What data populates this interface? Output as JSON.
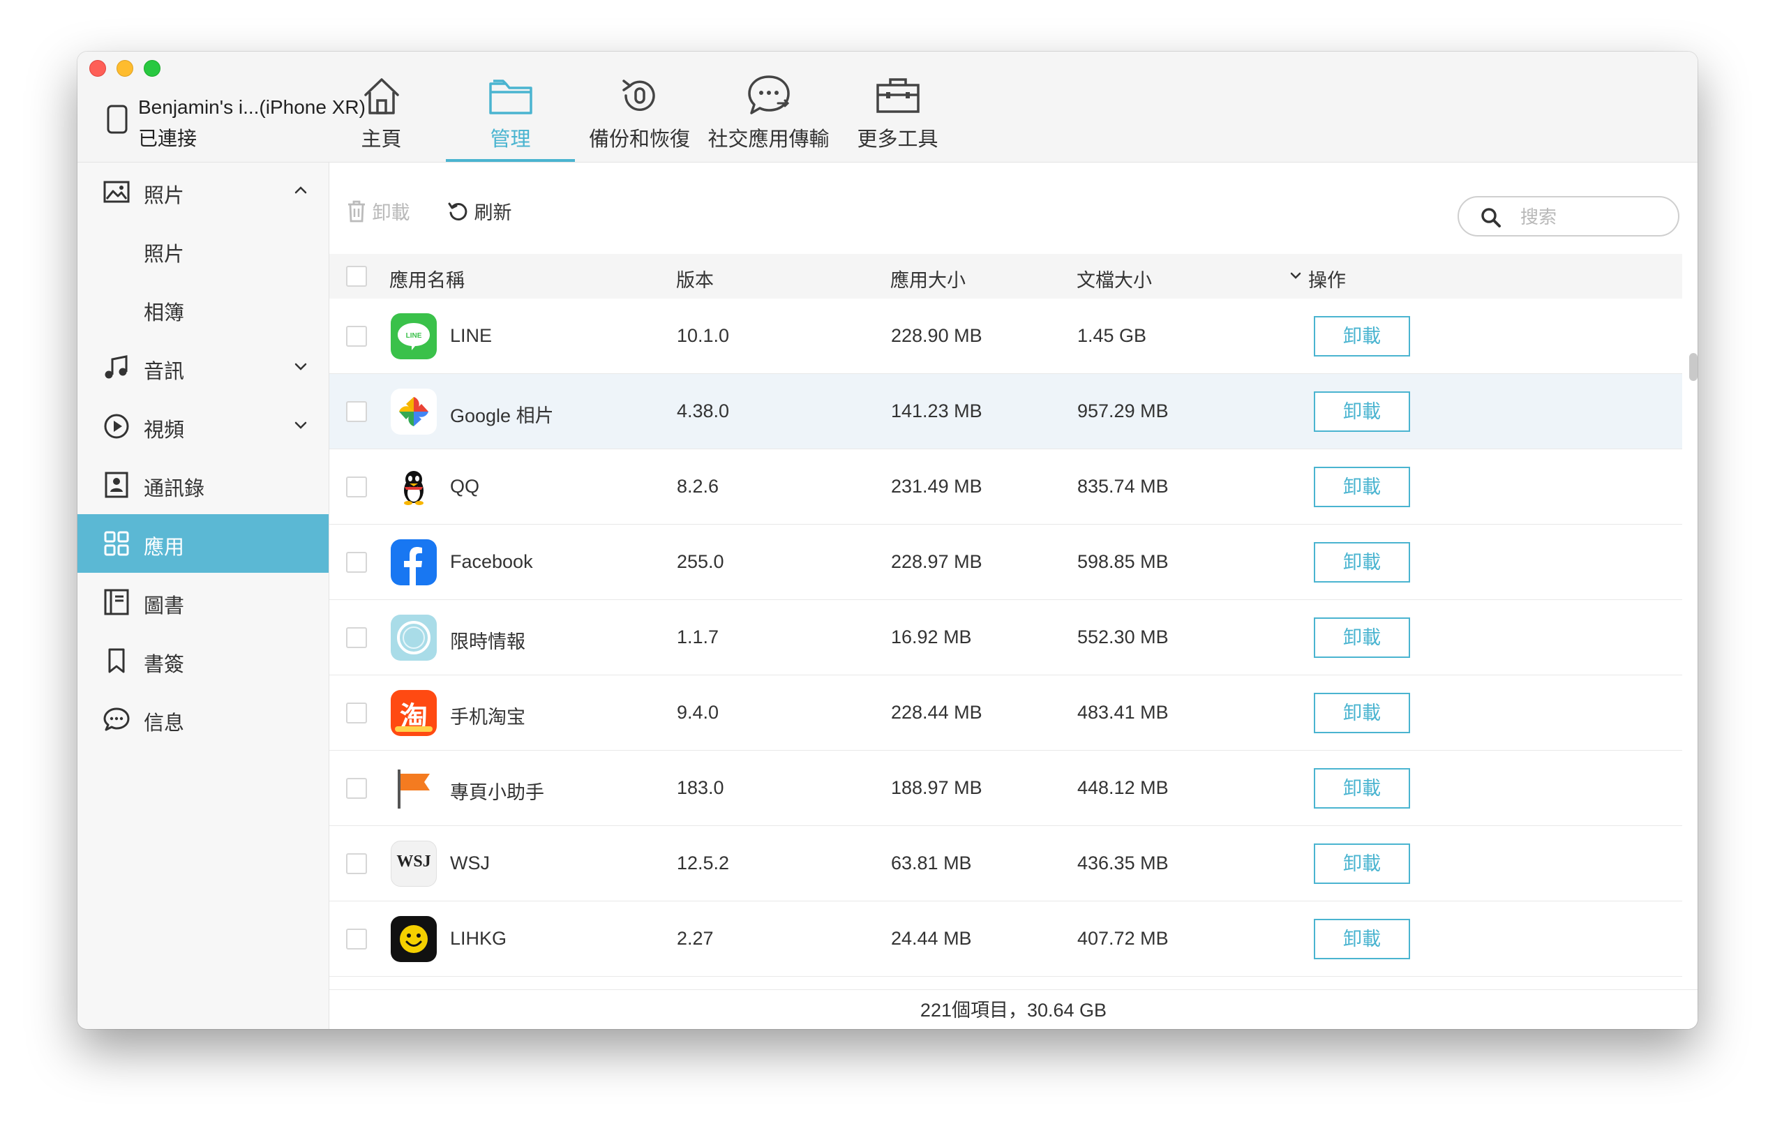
{
  "device": {
    "name": "Benjamin's i...(iPhone  XR)",
    "status": "已連接"
  },
  "tabs": [
    {
      "label": "主頁",
      "icon": "home-icon",
      "active": false
    },
    {
      "label": "管理",
      "icon": "folder-icon",
      "active": true
    },
    {
      "label": "備份和恢復",
      "icon": "backup-restore-icon",
      "active": false
    },
    {
      "label": "社交應用傳輸",
      "icon": "chat-transfer-icon",
      "active": false
    },
    {
      "label": "更多工具",
      "icon": "toolbox-icon",
      "active": false
    }
  ],
  "sidebar": {
    "items": [
      {
        "label": "照片",
        "icon": "photo-icon",
        "expanded": true
      },
      {
        "label": "照片"
      },
      {
        "label": "相簿"
      },
      {
        "label": "音訊",
        "icon": "music-icon"
      },
      {
        "label": "視頻",
        "icon": "video-icon"
      },
      {
        "label": "通訊錄",
        "icon": "contacts-icon"
      },
      {
        "label": "應用",
        "icon": "apps-icon",
        "active": true
      },
      {
        "label": "圖書",
        "icon": "books-icon"
      },
      {
        "label": "書簽",
        "icon": "bookmark-icon"
      },
      {
        "label": "信息",
        "icon": "message-icon"
      }
    ]
  },
  "toolbar": {
    "uninstall_label": "卸載",
    "refresh_label": "刷新"
  },
  "search": {
    "placeholder": "搜索"
  },
  "table": {
    "columns": {
      "name": "應用名稱",
      "version": "版本",
      "app_size": "應用大小",
      "doc_size": "文檔大小",
      "action": "操作"
    },
    "rows": [
      {
        "name": "LINE",
        "version": "10.1.0",
        "app_size": "228.90 MB",
        "doc_size": "1.45 GB",
        "action": "卸載",
        "icon": "line-icon"
      },
      {
        "name": "Google 相片",
        "version": "4.38.0",
        "app_size": "141.23 MB",
        "doc_size": "957.29 MB",
        "action": "卸載",
        "icon": "google-photos-icon"
      },
      {
        "name": "QQ",
        "version": "8.2.6",
        "app_size": "231.49 MB",
        "doc_size": "835.74 MB",
        "action": "卸載",
        "icon": "qq-icon"
      },
      {
        "name": "Facebook",
        "version": "255.0",
        "app_size": "228.97 MB",
        "doc_size": "598.85 MB",
        "action": "卸載",
        "icon": "facebook-icon"
      },
      {
        "name": "限時情報",
        "version": "1.1.7",
        "app_size": "16.92 MB",
        "doc_size": "552.30 MB",
        "action": "卸載",
        "icon": "circle-app-icon"
      },
      {
        "name": "手机淘宝",
        "version": "9.4.0",
        "app_size": "228.44 MB",
        "doc_size": "483.41 MB",
        "action": "卸載",
        "icon": "taobao-icon",
        "icon_text": "淘"
      },
      {
        "name": "專頁小助手",
        "version": "183.0",
        "app_size": "188.97 MB",
        "doc_size": "448.12 MB",
        "action": "卸載",
        "icon": "flag-icon"
      },
      {
        "name": "WSJ",
        "version": "12.5.2",
        "app_size": "63.81 MB",
        "doc_size": "436.35 MB",
        "action": "卸載",
        "icon": "wsj-icon",
        "icon_text": "WSJ"
      },
      {
        "name": "LIHKG",
        "version": "2.27",
        "app_size": "24.44 MB",
        "doc_size": "407.72 MB",
        "action": "卸載",
        "icon": "lihkg-icon"
      }
    ]
  },
  "footer": {
    "summary": "221個項目，30.64 GB"
  },
  "colors": {
    "accent": "#4ab4d0",
    "active_sidebar": "#5bb8d4"
  }
}
